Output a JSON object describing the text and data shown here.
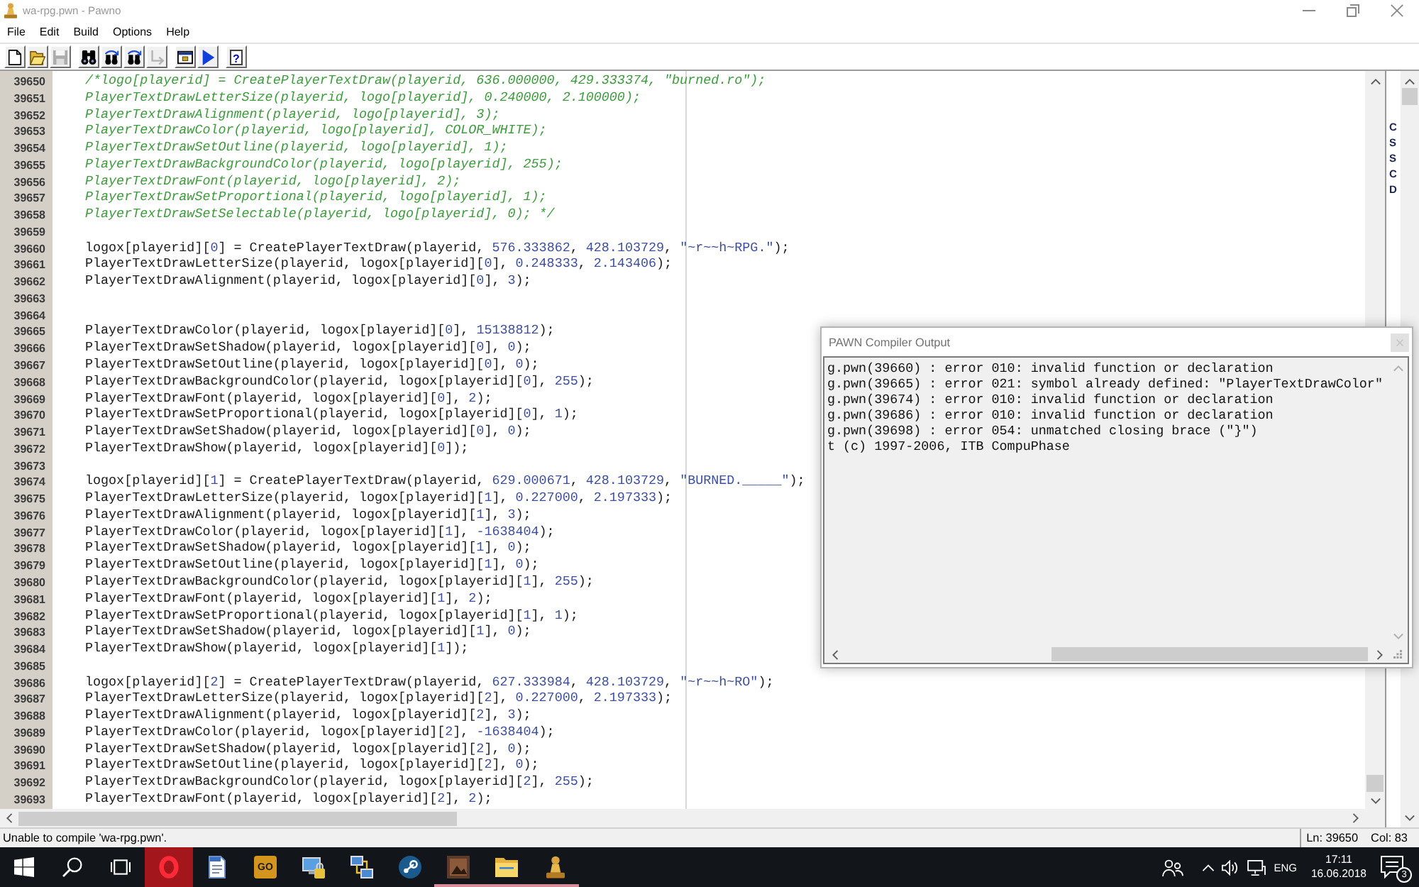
{
  "window": {
    "title": "wa-rpg.pwn - Pawno",
    "active": false
  },
  "menu": [
    "File",
    "Edit",
    "Build",
    "Options",
    "Help"
  ],
  "toolbar": {
    "groups": [
      [
        {
          "kind": "new",
          "disabled": false
        },
        {
          "kind": "open",
          "disabled": false
        },
        {
          "kind": "save",
          "disabled": true
        }
      ],
      [
        {
          "kind": "find",
          "disabled": false
        },
        {
          "kind": "find_next",
          "disabled": false
        },
        {
          "kind": "replace",
          "disabled": false
        },
        {
          "kind": "goto",
          "disabled": true
        }
      ],
      [
        {
          "kind": "options",
          "disabled": false
        },
        {
          "kind": "run",
          "disabled": false
        }
      ],
      [
        {
          "kind": "help",
          "symbol": "?",
          "disabled": false
        }
      ]
    ]
  },
  "editor": {
    "lines": [
      {
        "number": "39650",
        "kind": "comment",
        "text": "/*logo[playerid] = CreatePlayerTextDraw(playerid, 636.000000, 429.333374, \"burned.ro\");"
      },
      {
        "number": "39651",
        "kind": "comment",
        "text": "PlayerTextDrawLetterSize(playerid, logo[playerid], 0.240000, 2.100000);"
      },
      {
        "number": "39652",
        "kind": "comment",
        "text": "PlayerTextDrawAlignment(playerid, logo[playerid], 3);"
      },
      {
        "number": "39653",
        "kind": "comment",
        "text": "PlayerTextDrawColor(playerid, logo[playerid], COLOR_WHITE);"
      },
      {
        "number": "39654",
        "kind": "comment",
        "text": "PlayerTextDrawSetOutline(playerid, logo[playerid], 1);"
      },
      {
        "number": "39655",
        "kind": "comment",
        "text": "PlayerTextDrawBackgroundColor(playerid, logo[playerid], 255);"
      },
      {
        "number": "39656",
        "kind": "comment",
        "text": "PlayerTextDrawFont(playerid, logo[playerid], 2);"
      },
      {
        "number": "39657",
        "kind": "comment",
        "text": "PlayerTextDrawSetProportional(playerid, logo[playerid], 1);"
      },
      {
        "number": "39658",
        "kind": "comment",
        "text": "PlayerTextDrawSetSelectable(playerid, logo[playerid], 0); */"
      },
      {
        "number": "39659",
        "kind": "blank"
      },
      {
        "number": "39660",
        "kind": "code",
        "text": "logox[playerid][0] = CreatePlayerTextDraw(playerid, 576.333862, 428.103729, \"~r~~h~RPG.\");"
      },
      {
        "number": "39661",
        "kind": "code",
        "text": "PlayerTextDrawLetterSize(playerid, logox[playerid][0], 0.248333, 2.143406);"
      },
      {
        "number": "39662",
        "kind": "code",
        "text": "PlayerTextDrawAlignment(playerid, logox[playerid][0], 3);"
      },
      {
        "number": "39663",
        "kind": "blank"
      },
      {
        "number": "39664",
        "kind": "blank"
      },
      {
        "number": "39665",
        "kind": "code",
        "text": "PlayerTextDrawColor(playerid, logox[playerid][0], 15138812);"
      },
      {
        "number": "39666",
        "kind": "code",
        "text": "PlayerTextDrawSetShadow(playerid, logox[playerid][0], 0);"
      },
      {
        "number": "39667",
        "kind": "code",
        "text": "PlayerTextDrawSetOutline(playerid, logox[playerid][0], 0);"
      },
      {
        "number": "39668",
        "kind": "code",
        "text": "PlayerTextDrawBackgroundColor(playerid, logox[playerid][0], 255);"
      },
      {
        "number": "39669",
        "kind": "code",
        "text": "PlayerTextDrawFont(playerid, logox[playerid][0], 2);"
      },
      {
        "number": "39670",
        "kind": "code",
        "text": "PlayerTextDrawSetProportional(playerid, logox[playerid][0], 1);"
      },
      {
        "number": "39671",
        "kind": "code",
        "text": "PlayerTextDrawSetShadow(playerid, logox[playerid][0], 0);"
      },
      {
        "number": "39672",
        "kind": "code",
        "text": "PlayerTextDrawShow(playerid, logox[playerid][0]);"
      },
      {
        "number": "39673",
        "kind": "blank"
      },
      {
        "number": "39674",
        "kind": "code",
        "text": "logox[playerid][1] = CreatePlayerTextDraw(playerid, 629.000671, 428.103729, \"BURNED._____\");"
      },
      {
        "number": "39675",
        "kind": "code",
        "text": "PlayerTextDrawLetterSize(playerid, logox[playerid][1], 0.227000, 2.197333);"
      },
      {
        "number": "39676",
        "kind": "code",
        "text": "PlayerTextDrawAlignment(playerid, logox[playerid][1], 3);"
      },
      {
        "number": "39677",
        "kind": "code",
        "text": "PlayerTextDrawColor(playerid, logox[playerid][1], -1638404);"
      },
      {
        "number": "39678",
        "kind": "code",
        "text": "PlayerTextDrawSetShadow(playerid, logox[playerid][1], 0);"
      },
      {
        "number": "39679",
        "kind": "code",
        "text": "PlayerTextDrawSetOutline(playerid, logox[playerid][1], 0);"
      },
      {
        "number": "39680",
        "kind": "code",
        "text": "PlayerTextDrawBackgroundColor(playerid, logox[playerid][1], 255);"
      },
      {
        "number": "39681",
        "kind": "code",
        "text": "PlayerTextDrawFont(playerid, logox[playerid][1], 2);"
      },
      {
        "number": "39682",
        "kind": "code",
        "text": "PlayerTextDrawSetProportional(playerid, logox[playerid][1], 1);"
      },
      {
        "number": "39683",
        "kind": "code",
        "text": "PlayerTextDrawSetShadow(playerid, logox[playerid][1], 0);"
      },
      {
        "number": "39684",
        "kind": "code",
        "text": "PlayerTextDrawShow(playerid, logox[playerid][1]);"
      },
      {
        "number": "39685",
        "kind": "blank"
      },
      {
        "number": "39686",
        "kind": "code",
        "text": "logox[playerid][2] = CreatePlayerTextDraw(playerid, 627.333984, 428.103729, \"~r~~h~RO\");"
      },
      {
        "number": "39687",
        "kind": "code",
        "text": "PlayerTextDrawLetterSize(playerid, logox[playerid][2], 0.227000, 2.197333);"
      },
      {
        "number": "39688",
        "kind": "code",
        "text": "PlayerTextDrawAlignment(playerid, logox[playerid][2], 3);"
      },
      {
        "number": "39689",
        "kind": "code",
        "text": "PlayerTextDrawColor(playerid, logox[playerid][2], -1638404);"
      },
      {
        "number": "39690",
        "kind": "code",
        "text": "PlayerTextDrawSetShadow(playerid, logox[playerid][2], 0);"
      },
      {
        "number": "39691",
        "kind": "code",
        "text": "PlayerTextDrawSetOutline(playerid, logox[playerid][2], 0);"
      },
      {
        "number": "39692",
        "kind": "code",
        "text": "PlayerTextDrawBackgroundColor(playerid, logox[playerid][2], 255);"
      },
      {
        "number": "39693",
        "kind": "code",
        "text": "PlayerTextDrawFont(playerid, logox[playerid][2], 2);"
      }
    ]
  },
  "function_list": {
    "items": [
      "C",
      "S",
      "S",
      "C",
      "D"
    ]
  },
  "compiler_output": {
    "title": "PAWN Compiler Output",
    "messages": [
      "g.pwn(39660) : error 010: invalid function or declaration",
      "g.pwn(39665) : error 021: symbol already defined: \"PlayerTextDrawColor\"",
      "g.pwn(39674) : error 010: invalid function or declaration",
      "g.pwn(39686) : error 010: invalid function or declaration",
      "g.pwn(39698) : error 054: unmatched closing brace (\"}\")",
      "t (c) 1997-2006, ITB CompuPhase"
    ]
  },
  "status_bar": {
    "message": "Unable to compile 'wa-rpg.pwn'.",
    "line": "Ln: 39650",
    "column": "Col: 83"
  },
  "taskbar": {
    "apps": [
      {
        "kind": "browser",
        "running": false,
        "attention": true
      },
      {
        "kind": "document",
        "running": false,
        "attention": false
      },
      {
        "kind": "badge",
        "label": "GO",
        "running": false,
        "attention": false
      },
      {
        "kind": "monitor_lock",
        "running": false,
        "attention": false
      },
      {
        "kind": "network",
        "running": false,
        "attention": false
      },
      {
        "kind": "round_logo",
        "running": false,
        "attention": false
      },
      {
        "kind": "picture",
        "running": true,
        "attention": false
      },
      {
        "kind": "folder",
        "running": true,
        "attention": false
      },
      {
        "kind": "pawn",
        "running": true,
        "attention": false
      }
    ],
    "tray": {
      "language": "ENG",
      "time": "17:11",
      "date": "16.06.2018",
      "notifications": "3"
    }
  }
}
